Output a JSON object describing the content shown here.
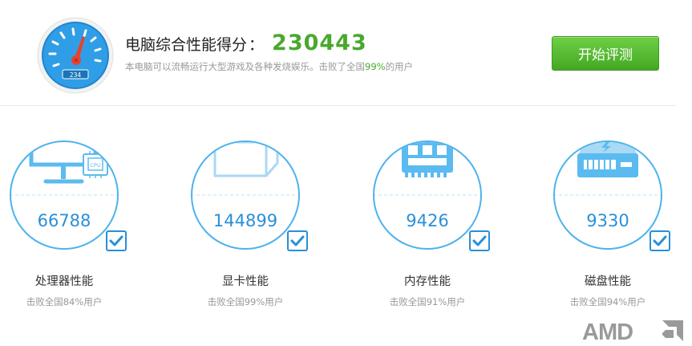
{
  "header": {
    "gauge_reading": "234",
    "title": "电脑综合性能得分",
    "colon": "：",
    "score": "230443",
    "subtitle_prefix": "本电脑可以流畅运行大型游戏及各种发烧娱乐。击败了全国",
    "subtitle_percent": "99%",
    "subtitle_suffix": "的用户",
    "start_button": "开始评测",
    "score_color": "#4aa82e"
  },
  "cards": [
    {
      "icon": "cpu-monitor-icon",
      "icon_label": "CPU",
      "value": "66788",
      "name": "处理器性能",
      "rank": "击败全国84%用户"
    },
    {
      "icon": "graphics-card-icon",
      "value": "144899",
      "name": "显卡性能",
      "rank": "击败全国99%用户"
    },
    {
      "icon": "memory-module-icon",
      "value": "9426",
      "name": "内存性能",
      "rank": "击败全国91%用户"
    },
    {
      "icon": "hard-disk-icon",
      "value": "9330",
      "name": "磁盘性能",
      "rank": "击败全国94%用户"
    }
  ],
  "brand": {
    "logo": "AMD"
  },
  "colors": {
    "accent_blue": "#2a8fd8",
    "ring_blue": "#4db3ec",
    "green": "#4aa82e"
  }
}
